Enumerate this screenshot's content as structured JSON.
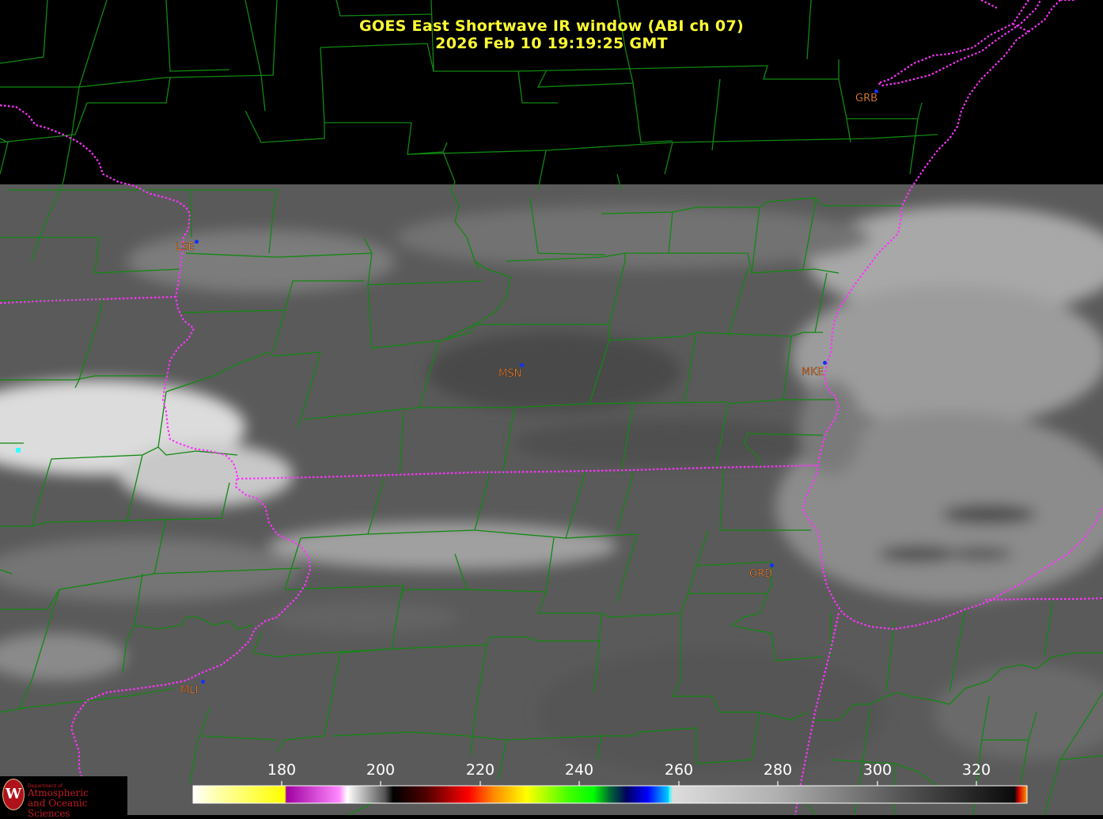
{
  "title": {
    "line1": "GOES East Shortwave IR window (ABI ch 07)",
    "line2": "2026 Feb 10  19:19:25 GMT"
  },
  "stations": [
    {
      "code": "GRB"
    },
    {
      "code": "LSE"
    },
    {
      "code": "MSN"
    },
    {
      "code": "MKE"
    },
    {
      "code": "ORD"
    },
    {
      "code": "MLI"
    }
  ],
  "colorbar": {
    "ticks": [
      "180",
      "200",
      "220",
      "240",
      "260",
      "280",
      "300",
      "320"
    ],
    "stops": [
      "#ffffff",
      "#ffff00",
      "#ff00ff",
      "#ffffff",
      "#000000",
      "#ff0000",
      "#ffff00",
      "#00ff00",
      "#000080",
      "#00ffff",
      "#ffffff",
      "#000000",
      "#ff8800"
    ]
  },
  "logo": {
    "small": "Department of",
    "line1": "Atmospheric",
    "line2": "and Oceanic Sciences",
    "emblem": "W"
  },
  "colors": {
    "county_lines": "#118811",
    "state_lines": "#ff33ff",
    "title": "#ffff33",
    "station_label": "#ff8c3a",
    "station_dot": "#1030ff"
  }
}
